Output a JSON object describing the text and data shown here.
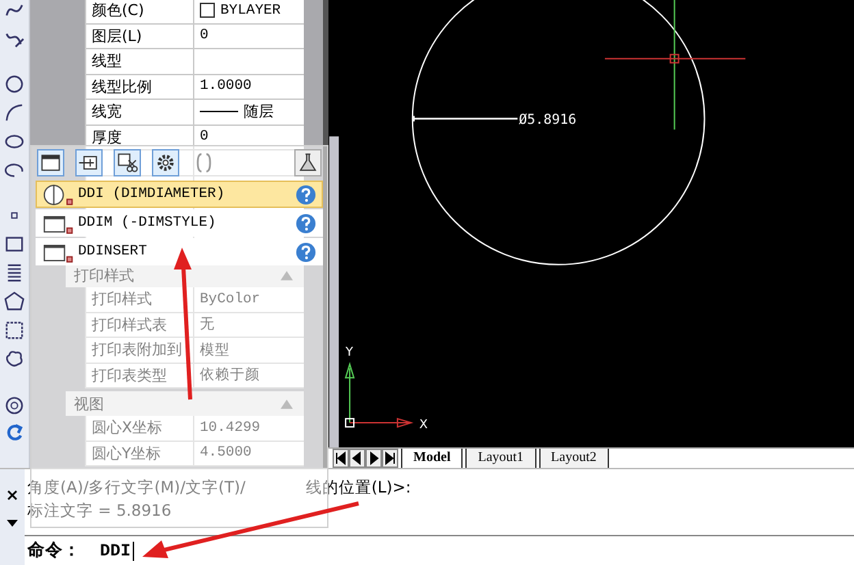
{
  "properties": [
    {
      "kind": "swatch",
      "label": "颜色(C)",
      "value": "BYLAYER"
    },
    {
      "kind": "row",
      "label": "图层(L)",
      "value": "0"
    },
    {
      "kind": "row",
      "label": "线型"
    },
    {
      "kind": "row",
      "label": "线型比例",
      "value": "1.0000"
    },
    {
      "kind": "lineweight",
      "label": "线宽",
      "value": "随层"
    },
    {
      "kind": "row",
      "label": "厚度",
      "value": "0"
    },
    {
      "kind": "row"
    },
    {
      "kind": "row"
    },
    {
      "kind": "row"
    },
    {
      "kind": "row"
    },
    {
      "kind": "section",
      "label": "打印样式",
      "expanded": true
    },
    {
      "kind": "row",
      "label": "打印样式",
      "value": "ByColor"
    },
    {
      "kind": "row",
      "label": "打印样式表",
      "value": "无"
    },
    {
      "kind": "row",
      "label": "打印表附加到",
      "value": "模型"
    },
    {
      "kind": "row",
      "label": "打印表类型",
      "value": "依赖于颜"
    },
    {
      "kind": "section",
      "label": "视图",
      "expanded": true
    },
    {
      "kind": "row",
      "label": "圆心X坐标",
      "value": "10.4299"
    },
    {
      "kind": "row",
      "label": "圆心Y坐标",
      "value": "4.5000"
    }
  ],
  "command_suggestions": [
    {
      "kind": "diameter",
      "label": "DDI (DIMDIAMETER)",
      "selected": true
    },
    {
      "kind": "dialog",
      "label": "DDIM (-DIMSTYLE)",
      "selected": false
    },
    {
      "kind": "dialog",
      "label": "DDINSERT",
      "selected": false
    }
  ],
  "drawing": {
    "dimension_text": "Ø5.8916",
    "y_axis_label": "Y",
    "x_axis_label": "X"
  },
  "layout_tabs": [
    {
      "label": "Model",
      "selected": true
    },
    {
      "label": "Layout1",
      "selected": false
    },
    {
      "label": "Layout2",
      "selected": false
    }
  ],
  "command_window": {
    "history": [
      [
        "角度(A)/多行文字(M)/文字(T)/",
        "线的位置(L)>:"
      ],
      [
        "标注文字 = 5.8916"
      ]
    ],
    "prompt": "命令：",
    "input": "DDI"
  }
}
